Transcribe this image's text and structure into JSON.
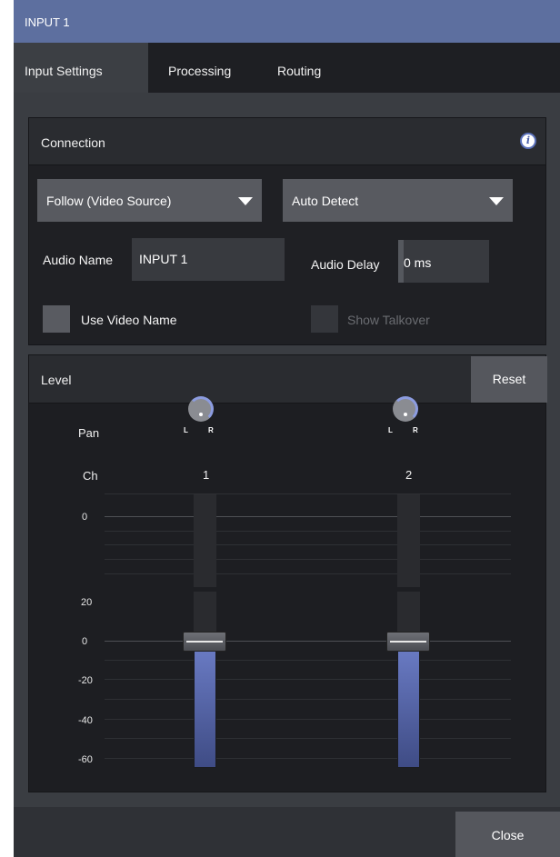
{
  "window": {
    "title": "INPUT 1"
  },
  "tabs": [
    "Input Settings",
    "Processing",
    "Routing"
  ],
  "connection": {
    "header": "Connection",
    "source_dropdown": "Follow (Video Source)",
    "detect_dropdown": "Auto Detect",
    "audio_name_label": "Audio Name",
    "audio_name_value": "INPUT 1",
    "audio_delay_label": "Audio Delay",
    "audio_delay_value": "0 ms",
    "use_video_name_label": "Use Video Name",
    "show_talkover_label": "Show Talkover"
  },
  "level": {
    "header": "Level",
    "reset_label": "Reset",
    "pan_label": "Pan",
    "ch_label": "Ch",
    "pan_l": "L",
    "pan_r": "R",
    "channels": [
      "1",
      "2"
    ],
    "scale_top": [
      "0",
      "20"
    ],
    "scale_bottom": [
      "0",
      "-20",
      "-40",
      "-60"
    ]
  },
  "footer": {
    "close_label": "Close"
  },
  "colors": {
    "title_bar": "#5d6f9f",
    "meter": "#5566aa",
    "knob_ring": "#8c9ce0"
  }
}
